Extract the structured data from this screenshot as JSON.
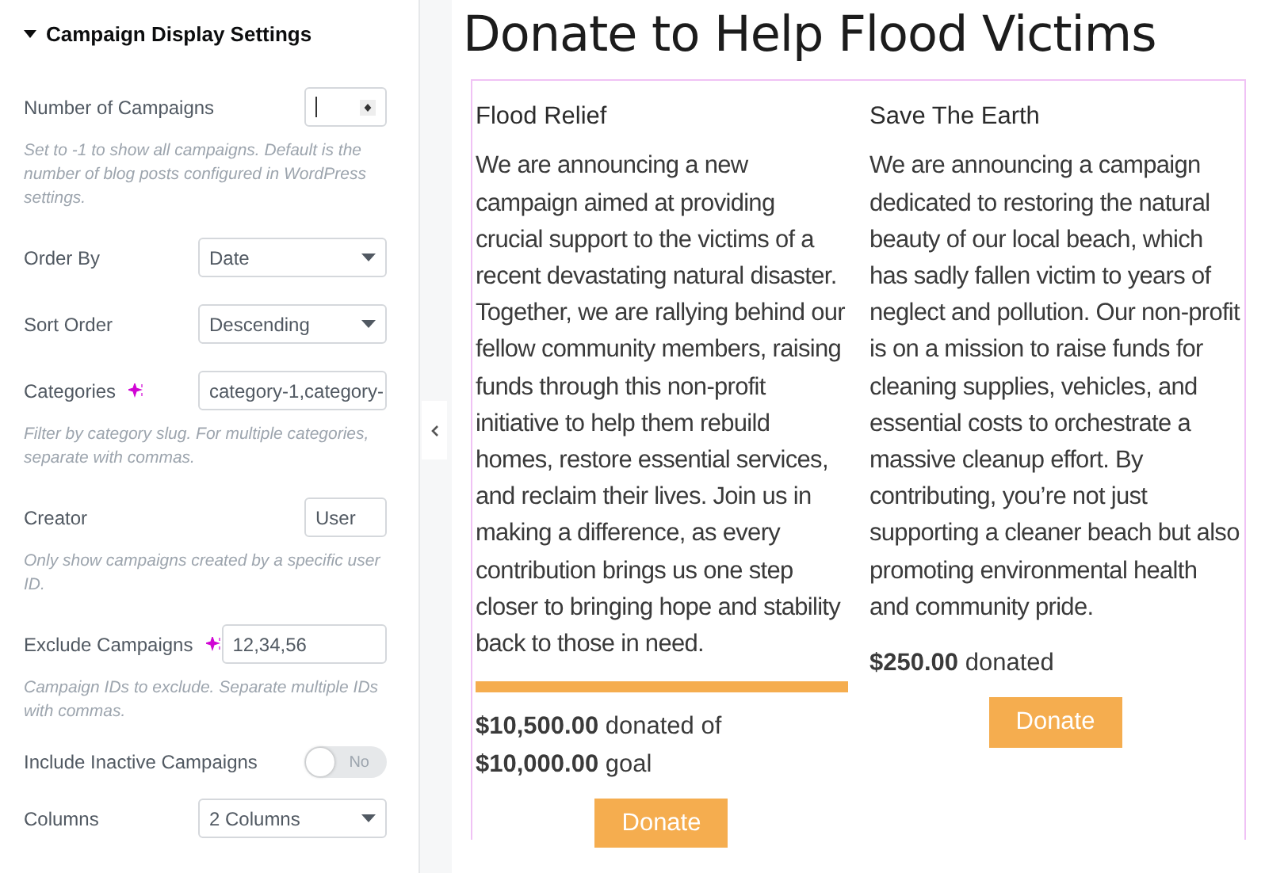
{
  "panel": {
    "section": {
      "title": "Campaign Display Settings",
      "expanded": true
    },
    "controls": [
      {
        "kind": "number",
        "label": "Number of Campaigns",
        "hint": "Set to -1 to show all campaigns. Default is the number of blog posts configured in WordPress settings."
      },
      {
        "kind": "select",
        "label": "Order By",
        "value": "Date"
      },
      {
        "kind": "select",
        "label": "Sort Order",
        "value": "Descending"
      },
      {
        "kind": "text",
        "label": "Categories",
        "ai": true,
        "value": "category-1,category-",
        "hint": "Filter by category slug. For multiple categories, separate with commas."
      },
      {
        "kind": "text",
        "label": "Creator",
        "value": "User",
        "hint": "Only show campaigns created by a specific user ID."
      },
      {
        "kind": "text",
        "label": "Exclude Campaigns",
        "ai": true,
        "value": "12,34,56",
        "hint": "Campaign IDs to exclude. Separate multiple IDs with commas."
      },
      {
        "kind": "toggle",
        "label": "Include Inactive Campaigns",
        "on": false,
        "state_text": "No"
      },
      {
        "kind": "select",
        "label": "Columns",
        "value": "2 Columns"
      }
    ]
  },
  "main": {
    "title": "Donate to Help Flood Victims",
    "campaigns": [
      {
        "name": "Flood Relief",
        "description": "We are announcing a new campaign aimed at providing crucial support to the victims of a recent devastating natural disaster. Together, we are rallying behind our fellow community members, raising funds through this non-profit initiative to help them rebuild homes, restore essential services, and reclaim their lives. Join us in making a difference, as every contribution brings us one step closer to bringing hope and stability back to those in need.",
        "progress": {
          "level": 1
        },
        "raised": "**$10,500.00** donated of **$10,000.00** goal",
        "button": "Donate"
      },
      {
        "name": "Save The Earth",
        "description": "We are announcing a campaign dedicated to restoring the natural beauty of our local beach, which has sadly fallen victim to years of neglect and pollution. Our non-profit is on a mission to raise funds for cleaning supplies, vehicles, and essential costs to orchestrate a massive cleanup effort. By contributing, you’re not just supporting a cleaner beach but also promoting environmental health and community pride.",
        "raised": "**$250.00** donated",
        "button": "Donate"
      }
    ]
  }
}
